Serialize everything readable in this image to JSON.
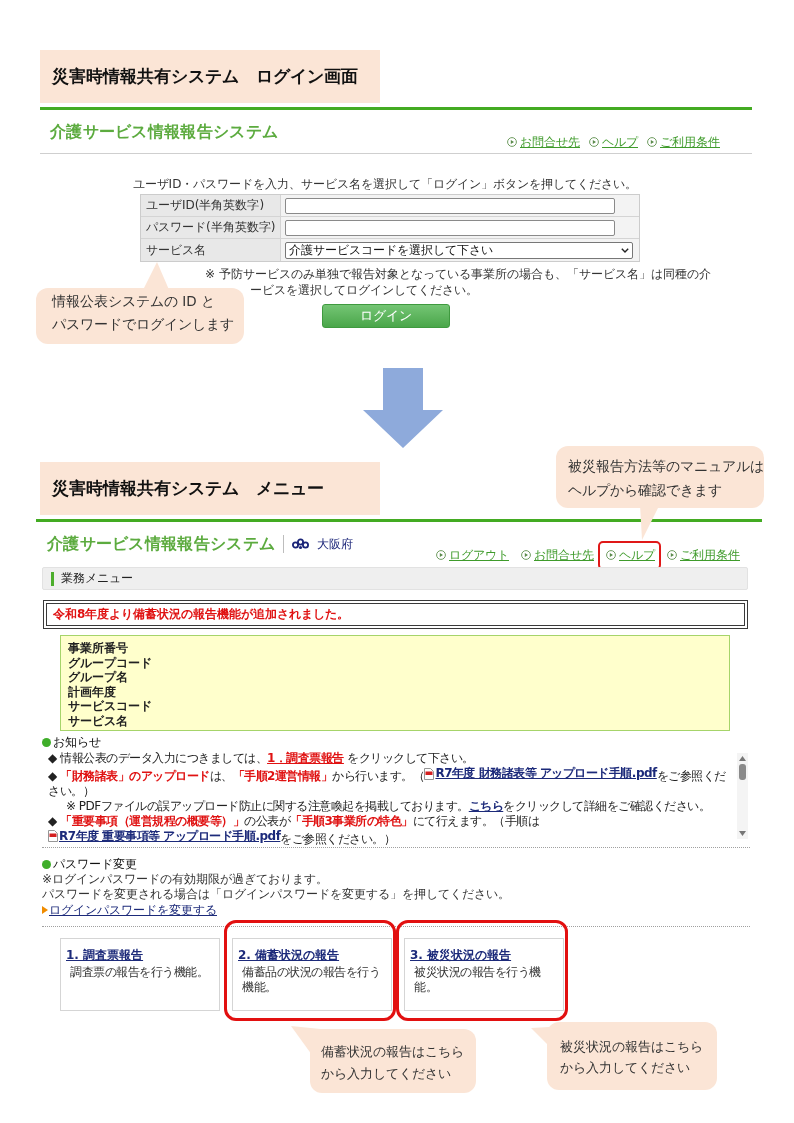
{
  "login_section": {
    "title": "災害時情報共有システム　ログイン画面"
  },
  "login_screen": {
    "app_title": "介護サービス情報報告システム",
    "header_links": [
      {
        "label": "お問合せ先"
      },
      {
        "label": "ヘルプ"
      },
      {
        "label": "ご利用条件"
      }
    ],
    "instruction": "ユーザID・パスワードを入力、サービス名を選択して「ログイン」ボタンを押してください。",
    "fields": [
      {
        "label": "ユーザID(半角英数字)",
        "kind": "input"
      },
      {
        "label": "パスワード(半角英数字)",
        "kind": "input"
      },
      {
        "label": "サービス名",
        "kind": "select",
        "value": "介護サービスコードを選択して下さい"
      }
    ],
    "note_lines": [
      "※ 予防サービスのみ単独で報告対象となっている事業所の場合も、「サービス名」は同種の介",
      "ービスを選択してログインしてください。"
    ],
    "login_button": "ログイン"
  },
  "login_callout": {
    "lines": [
      "情報公表システムの ID と",
      "パスワードでログインします"
    ]
  },
  "menu_section": {
    "title": "災害時情報共有システム　メニュー"
  },
  "help_callout": {
    "lines": [
      "被災報告方法等のマニュアルは",
      "ヘルプから確認できます"
    ]
  },
  "menu_screen": {
    "app_title": "介護サービス情報報告システム",
    "prefecture": "大阪府",
    "header_links": [
      {
        "label": "ログアウト",
        "highlighted": false
      },
      {
        "label": "お問合せ先",
        "highlighted": false
      },
      {
        "label": "ヘルプ",
        "highlighted": true
      },
      {
        "label": "ご利用条件",
        "highlighted": false
      }
    ],
    "menu_heading": "業務メニュー",
    "announcement": "令和8年度より備蓄状況の報告機能が追加されました。",
    "office_info_labels": [
      "事業所番号",
      "グループコード",
      "グループ名",
      "計画年度",
      "サービスコード",
      "サービス名"
    ],
    "notices": {
      "heading": "お知らせ",
      "lines": [
        {
          "kind": "item",
          "segments": [
            {
              "kind": "text",
              "text": "◆ 情報公表のデータ入力につきましては、"
            },
            {
              "kind": "red_link",
              "text": "1．調査票報告"
            },
            {
              "kind": "text",
              "text": " をクリックして下さい。"
            }
          ]
        },
        {
          "kind": "item",
          "segments": [
            {
              "kind": "text",
              "text": "◆ "
            },
            {
              "kind": "emphasis",
              "text": "「財務諸表」のアップロード"
            },
            {
              "kind": "text",
              "text": "は、"
            },
            {
              "kind": "emphasis",
              "text": "「手順2運営情報」"
            },
            {
              "kind": "text",
              "text": "から行います。（"
            },
            {
              "kind": "file_link",
              "text": "R7年度 財務諸表等 アップロード手順.pdf"
            },
            {
              "kind": "text",
              "text": "をご参照ください。）"
            }
          ]
        },
        {
          "kind": "subnote",
          "segments": [
            {
              "kind": "text",
              "text": "※ PDFファイルの誤アップロード防止に関する注意喚起を掲載しております。"
            },
            {
              "kind": "link",
              "text": "こちら"
            },
            {
              "kind": "text",
              "text": "をクリックして詳細をご確認ください。"
            }
          ]
        },
        {
          "kind": "item",
          "segments": [
            {
              "kind": "text",
              "text": "◆ "
            },
            {
              "kind": "emphasis",
              "text": "「重要事項（運営規程の概要等）」"
            },
            {
              "kind": "text",
              "text": "の公表が"
            },
            {
              "kind": "emphasis",
              "text": "「手順3事業所の特色」"
            },
            {
              "kind": "text",
              "text": "にて行えます。（手順は"
            },
            {
              "kind": "file_link",
              "text": "R7年度 重要事項等 アップロード手順.pdf"
            },
            {
              "kind": "text",
              "text": "をご参照ください。）"
            }
          ]
        }
      ]
    },
    "password_change": {
      "heading": "パスワード変更",
      "lines": [
        "※ログインパスワードの有効期限が過ぎております。",
        "パスワードを変更される場合は「ログインパスワードを変更する」を押してください。"
      ],
      "link": "ログインパスワードを変更する"
    },
    "cards": [
      {
        "title": "1. 調査票報告",
        "description": "調査票の報告を行う機能。",
        "highlighted": false
      },
      {
        "title": "2. 備蓄状況の報告",
        "description": "備蓄品の状況の報告を行う機能。",
        "highlighted": true
      },
      {
        "title": "3. 被災状況の報告",
        "description": "被災状況の報告を行う機能。",
        "highlighted": true
      }
    ]
  },
  "card_callouts": [
    {
      "lines": [
        "備蓄状況の報告はこちら",
        "から入力してください"
      ]
    },
    {
      "lines": [
        "被災状況の報告はこちら",
        "から入力してください"
      ]
    }
  ]
}
